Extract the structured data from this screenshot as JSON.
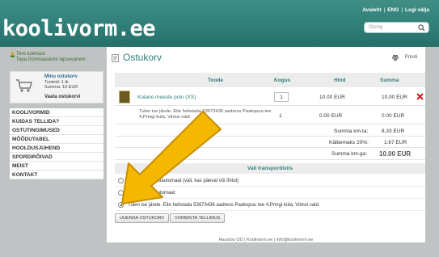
{
  "header": {
    "logo": "koolivorm.ee",
    "links": [
      "Avaleht",
      "ENG",
      "Logi välja"
    ],
    "search_placeholder": "Otsing"
  },
  "sidebar": {
    "welcome_line1": "Tere tulemast",
    "welcome_line2": "Tapa Gümnaasiumi lapsevanem",
    "cart": {
      "title": "Minu ostukorv",
      "items_label": "Tooteid:",
      "items_value": "1 tk",
      "sum_label": "Summa:",
      "sum_value": "10 EUR",
      "link": "Vaata ostukorvi"
    },
    "nav": [
      "KOOLIVORMID",
      "KUIDAS TELLIDA?",
      "OSTUTINGIMUSED",
      "MÕÕDUTABEL",
      "HOOLDUSJUHEND",
      "SPORDIRÕIVAD",
      "MEIST",
      "KONTAKT"
    ]
  },
  "main": {
    "title": "Ostukorv",
    "print": "Prindi",
    "columns": [
      "Toode",
      "Kogus",
      "Hind",
      "Summa"
    ],
    "product": {
      "name": "Kolane meeste polo (XS)",
      "qty": "1",
      "price": "10.00 EUR",
      "sum": "10.00 EUR"
    },
    "delivery": {
      "desc": "Tulen ise järele. Eile helistada 53973436 aadress Paakspuu tee 4,Pringi küla, Viimsi vald",
      "qty": "1",
      "price": "0.00 EUR",
      "sum": "0.00 EUR"
    },
    "totals": {
      "total_label": "Summa km-ta:",
      "total_value": "8.33 EUR",
      "vat_label": "Käibemaks 20%:",
      "vat_value": "1.67 EUR",
      "grand_label": "Summa km-ga:",
      "grand_value": "10.00 EUR"
    },
    "transport_title": "Vali transpordiviis",
    "transport_options": [
      "Smartposti pakiautomaat (vali, kas päeval või õhtul)",
      "Omniva pakiautomaat",
      "Tulen ise järele. Eile helistada 53973436 aadress Paakspuu tee 4,Pringi küla, Viimsi vald."
    ],
    "buttons": [
      "UUENDA OSTUKORV",
      "VORMISTA TELLIMUS"
    ],
    "footer": "Hausloo OÜ | Koolivorm.ee | info@koolivorm.ee"
  },
  "colors": {
    "header": "#2f7f78",
    "accent": "#2f7f78",
    "arrow": "#f5b800"
  }
}
